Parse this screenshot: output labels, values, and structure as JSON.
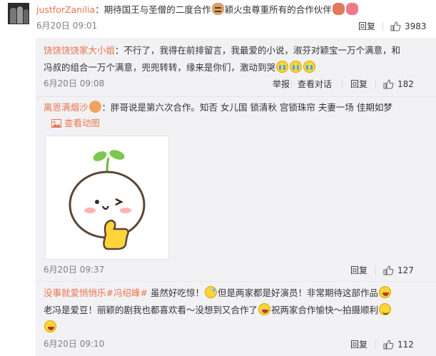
{
  "main_comment": {
    "user": "justforZanilia",
    "separator": "：",
    "text_a": "期待国王与圣僧的二度合作",
    "text_b": "颖火虫尊重所有的合作伙伴",
    "time": "6月20日 09:01",
    "reply": "回复",
    "likes": "3983"
  },
  "replies": [
    {
      "user": "饶饶饶饶家大小姐",
      "line1": "：不行了，我得在前排留言，我最爱的小说，淑芬对颖宝一万个满意，和",
      "line2": "冯叔的组合一万个满意，兜兜转转，缘来是你们，激动到哭",
      "time": "6月20日 09:08",
      "report": "举报",
      "view_conversation": "查看对话",
      "reply": "回复",
      "likes": "182"
    },
    {
      "user": "离恩满烟沙",
      "text": "：胖哥说是第六次合作。知否 女儿国 锁清秋 宫锁珠帘 夫妻一场 佳期如梦",
      "view_gif": "查看动图",
      "time": "6月20日 09:37",
      "reply": "回复",
      "likes": "127"
    },
    {
      "user": "没事就爱悄悄乐",
      "topic": "#冯绍峰#",
      "line1_a": " 虽然好吃惊！",
      "line1_b": "但是两家都是好演员！非常期待这部作品",
      "line2_a": "老冯是爱豆！丽颖的剧我也都喜欢看～没想到又合作了",
      "line2_b": "祝两家合作愉快～拍摄顺利",
      "time": "6月20日 09:10",
      "reply": "回复",
      "likes": "112"
    }
  ],
  "colors": {
    "username": "#eb7350",
    "meta": "#808080",
    "panel_bg": "#f2f2f5"
  }
}
